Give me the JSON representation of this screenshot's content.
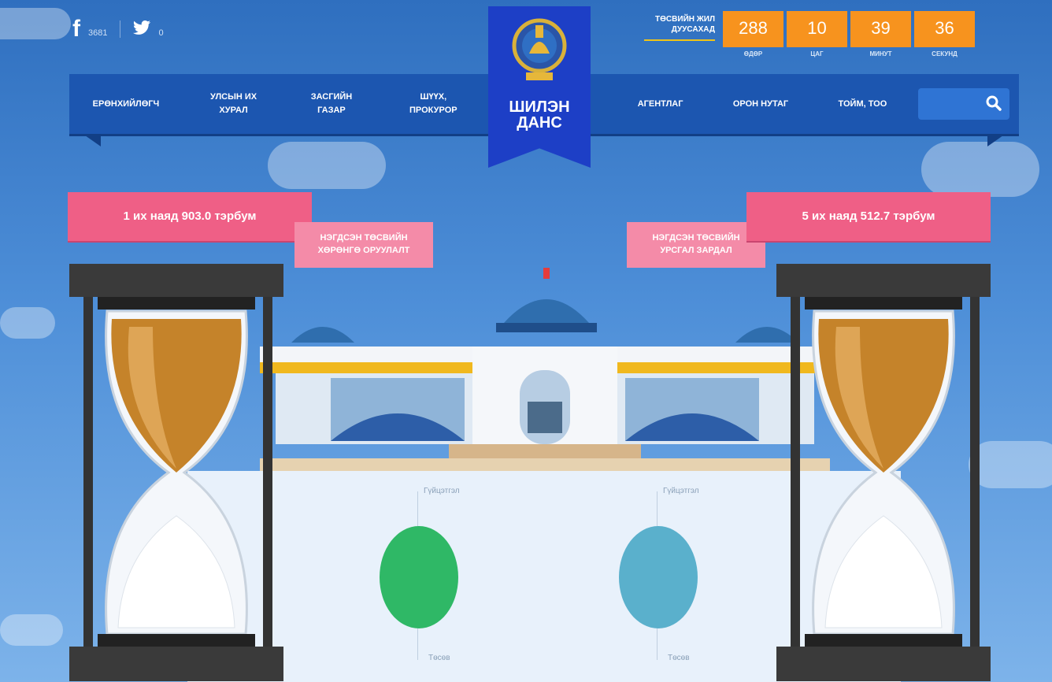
{
  "social": {
    "facebook_count": "3681",
    "twitter_count": "0"
  },
  "countdown": {
    "title_line1": "ТӨСВИЙН ЖИЛ",
    "title_line2": "ДУУСАХАД",
    "units": [
      {
        "value": "288",
        "label": "ӨДӨР"
      },
      {
        "value": "10",
        "label": "ЦАГ"
      },
      {
        "value": "39",
        "label": "МИНУТ"
      },
      {
        "value": "36",
        "label": "СЕКУНД"
      }
    ],
    "box_color": "#f7931e"
  },
  "nav": {
    "left": [
      "ЕРӨНХИЙЛӨГЧ",
      "УЛСЫН ИХ ХУРАЛ",
      "ЗАСГИЙН ГАЗАР",
      "ШҮҮХ, ПРОКУРОР"
    ],
    "right": [
      "АГЕНТЛАГ",
      "ОРОН НУТАГ",
      "ТОЙМ, ТОО"
    ],
    "search_placeholder": ""
  },
  "brand": {
    "title_line1": "ШИЛЭН",
    "title_line2": "ДАНС",
    "color": "#1d3fc6"
  },
  "income": {
    "amount": "1 их наяд 903.0 тэрбум",
    "label_line1": "НЭГДСЭН ТӨСВИЙН",
    "label_line2": "ХӨРӨНГӨ ОРУУЛАЛТ",
    "gauge_color": "#2fb866",
    "top_label": "Гүйцэтгэл",
    "bottom_label": "Төсөв"
  },
  "expense": {
    "amount": "5 их наяд 512.7 тэрбум",
    "label_line1": "НЭГДСЭН ТӨСВИЙН",
    "label_line2": "УРСГАЛ ЗАРДАЛ",
    "gauge_color": "#5ab0cc",
    "top_label": "Гүйцэтгэл",
    "bottom_label": "Төсөв"
  },
  "colors": {
    "ribbon": "#ef5f86",
    "nav": "#1c56b0",
    "sky": "#3f7fc9"
  }
}
